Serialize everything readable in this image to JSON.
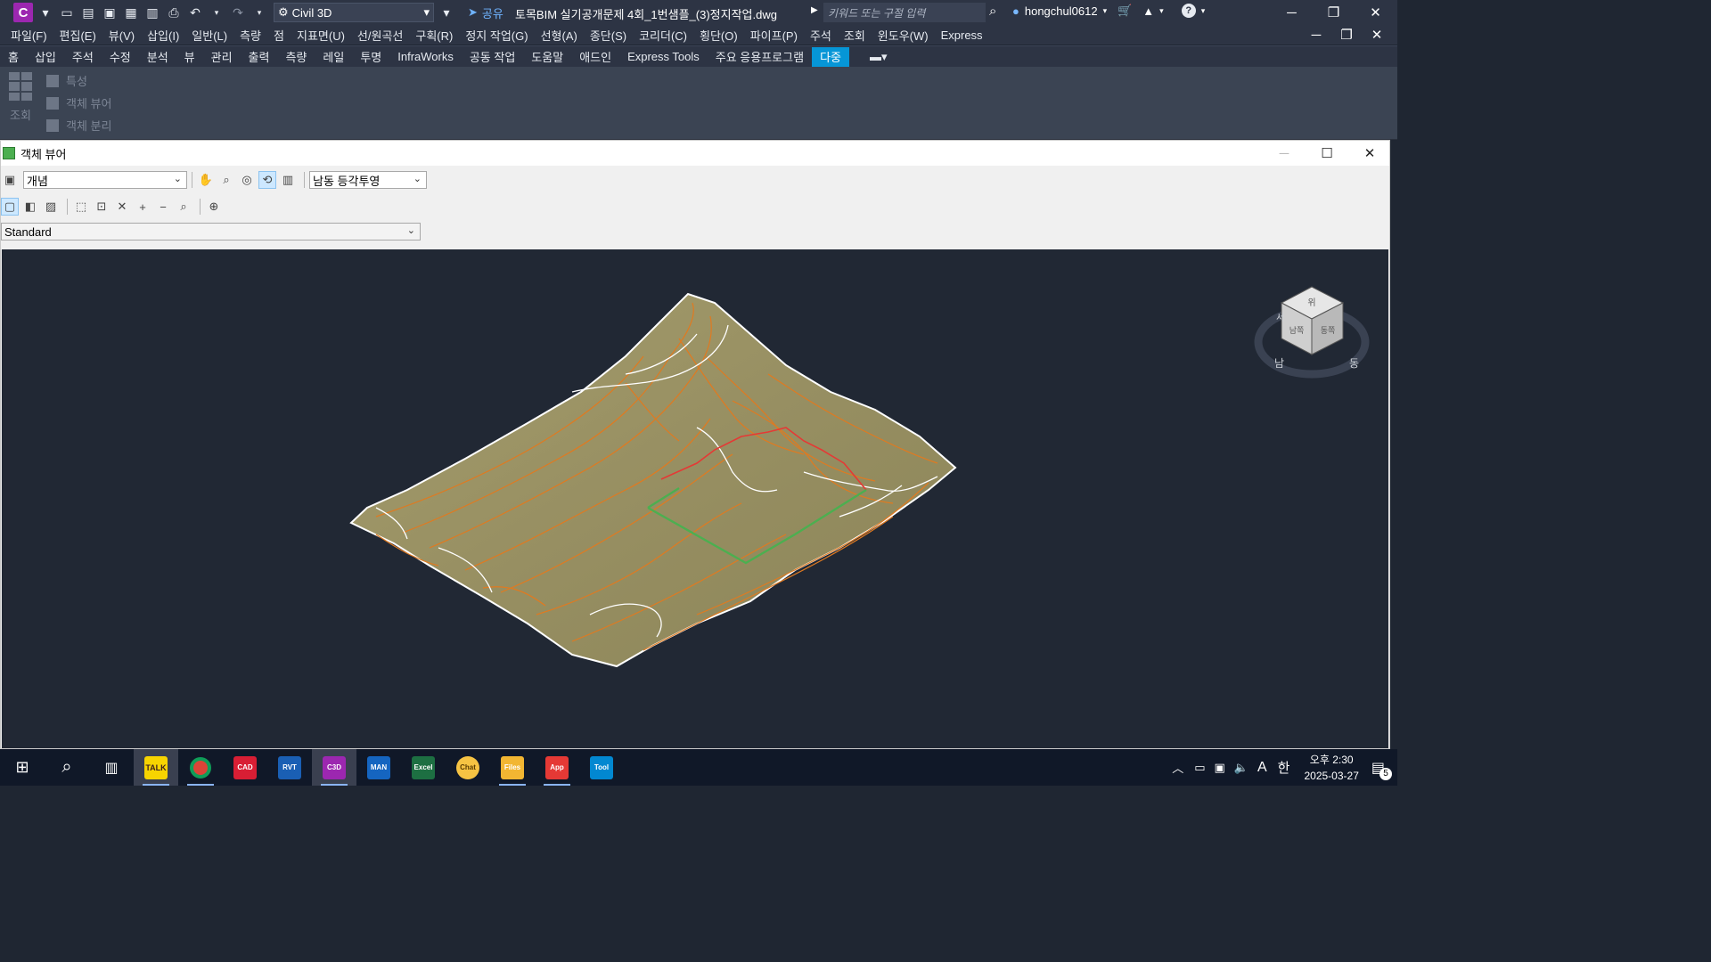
{
  "titlebar": {
    "workspace": "Civil 3D",
    "share": "공유",
    "document": "토목BIM 실기공개문제 4회_1번샘플_(3)정지작업.dwg",
    "search_placeholder": "키워드 또는 구절 입력",
    "user": "hongchul0612"
  },
  "menu": [
    "파일(F)",
    "편집(E)",
    "뷰(V)",
    "삽입(I)",
    "일반(L)",
    "측량",
    "점",
    "지표면(U)",
    "선/원곡선",
    "구획(R)",
    "정지 작업(G)",
    "선형(A)",
    "종단(S)",
    "코리더(C)",
    "횡단(O)",
    "파이프(P)",
    "주석",
    "조회",
    "윈도우(W)",
    "Express"
  ],
  "ribbon_tabs": [
    "홈",
    "삽입",
    "주석",
    "수정",
    "분석",
    "뷰",
    "관리",
    "출력",
    "측량",
    "레일",
    "투명",
    "InfraWorks",
    "공동 작업",
    "도움말",
    "애드인",
    "Express Tools",
    "주요 응용프로그램",
    "다중"
  ],
  "active_tab": "다중",
  "panel": {
    "group_label": "조회",
    "items": [
      "특성",
      "객체 뷰어",
      "객체 분리"
    ]
  },
  "viewer": {
    "title": "객체 뷰어",
    "visual_style": "개념",
    "view": "남동 등각투영",
    "style": "Standard"
  },
  "viewcube": {
    "top": "위",
    "front": "남쪽",
    "right": "동쪽",
    "compass_s": "남",
    "compass_e": "동",
    "compass_w": "서"
  },
  "taskbar": {
    "time": "오후 2:30",
    "date": "2025-03-27",
    "ime": "A",
    "lang": "한",
    "notifications": "5",
    "apps": [
      "TALK",
      "Chrome",
      "CAD",
      "RVT",
      "C3D",
      "MAN",
      "Excel",
      "Chat",
      "Files",
      "App",
      "Tool"
    ]
  },
  "colors": {
    "accent": "#0696d7",
    "terrain": "#9a9365",
    "contour": "#e07a20",
    "grading": "#4caf50",
    "feature_line": "#e53935"
  }
}
